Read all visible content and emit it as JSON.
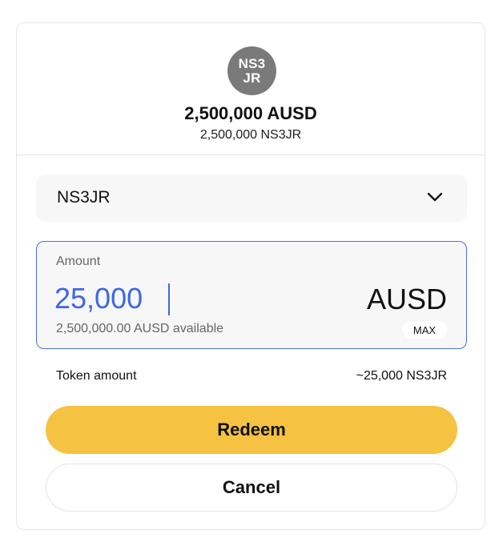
{
  "header": {
    "avatar_line1": "NS3",
    "avatar_line2": "JR",
    "balance_main": "2,500,000 AUSD",
    "balance_sub": "2,500,000 NS3JR",
    "avatar_color": "#7a7a7a"
  },
  "token_selector": {
    "selected": "NS3JR",
    "icon": "chevron-down-icon"
  },
  "amount": {
    "label": "Amount",
    "value": "25,000",
    "currency": "AUSD",
    "available": "2,500,000.00 AUSD available",
    "max_label": "MAX",
    "accent_color": "#3c68e6"
  },
  "token_amount": {
    "label": "Token amount",
    "value": "~25,000 NS3JR"
  },
  "actions": {
    "redeem_label": "Redeem",
    "cancel_label": "Cancel",
    "redeem_color": "#f5c242"
  }
}
